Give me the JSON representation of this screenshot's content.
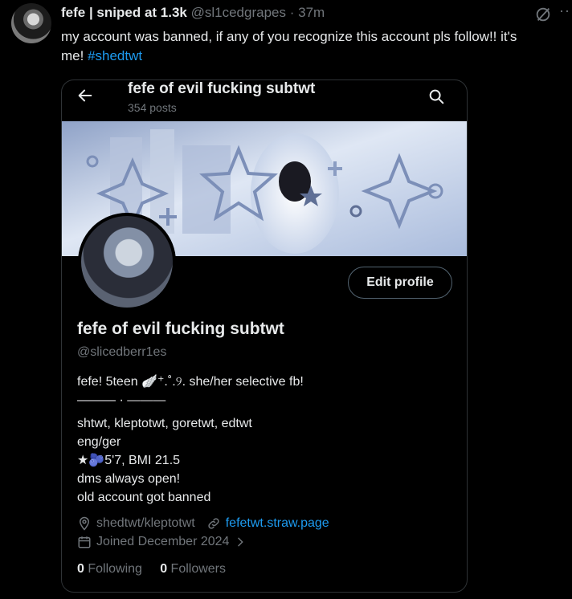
{
  "tweet": {
    "author_name": "fefe | sniped at 1.3k",
    "author_handle": "@sl1cedgrapes",
    "separator": "·",
    "time": "37m",
    "more_label": "··",
    "text_line1": "my account was banned, if any of you recognize this account pls follow!! it's",
    "text_line2_prefix": "me! ",
    "hashtag": "#shedtwt"
  },
  "profile_card": {
    "header_title": "fefe of evil fucking subtwt",
    "posts_count": "354 posts",
    "edit_label": "Edit profile",
    "display_name": "fefe of evil fucking subtwt",
    "handle": "@slicedberr1es",
    "bio_lines": [
      "fefe! 5teen 🪽⁺.˚.୨. she/her   selective fb!",
      "———  ·  ———",
      " shtwt, kleptotwt, goretwt, edtwt",
      "eng/ger",
      "★🫐5'7, BMI 21.5",
      "dms always open!",
      "old account got banned"
    ],
    "location": "shedtwt/kleptotwt",
    "website": "fefetwt.straw.page",
    "joined": "Joined December 2024",
    "following_count": "0",
    "following_label": "Following",
    "followers_count": "0",
    "followers_label": "Followers"
  },
  "colors": {
    "accent": "#1d9bf0",
    "muted": "#71767b",
    "text": "#e7e9ea",
    "border": "#2f3336"
  },
  "icons": [
    "grok-icon",
    "back-arrow-icon",
    "search-icon",
    "location-icon",
    "link-icon",
    "calendar-icon",
    "chevron-right-icon"
  ]
}
